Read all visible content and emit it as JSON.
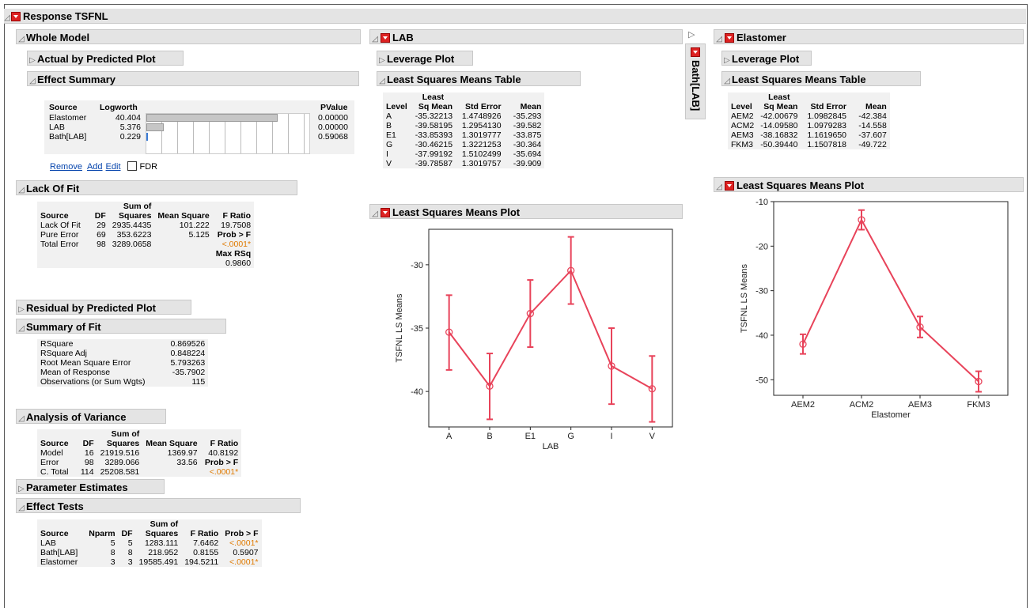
{
  "response_title": "Response TSFNL",
  "whole_model": {
    "title": "Whole Model",
    "actual_by_predicted": "Actual by Predicted Plot",
    "effect_summary": {
      "title": "Effect Summary",
      "headers": [
        "Source",
        "Logworth",
        "PValue"
      ],
      "rows": [
        {
          "source": "Elastomer",
          "logworth": "40.404",
          "pvalue": "0.00000",
          "bar": 40.404
        },
        {
          "source": "LAB",
          "logworth": "5.376",
          "pvalue": "0.00000",
          "bar": 5.376
        },
        {
          "source": "Bath[LAB]",
          "logworth": "0.229",
          "pvalue": "0.59068",
          "bar": 0.229
        }
      ],
      "links": {
        "remove": "Remove",
        "add": "Add",
        "edit": "Edit",
        "fdr": "FDR"
      }
    },
    "lack_of_fit": {
      "title": "Lack Of Fit",
      "h_sumof": "Sum of",
      "headers": [
        "Source",
        "DF",
        "Squares",
        "Mean Square",
        "F Ratio"
      ],
      "rows": [
        [
          "Lack Of Fit",
          "29",
          "2935.4435",
          "101.222",
          "19.7508"
        ],
        [
          "Pure Error",
          "69",
          "353.6223",
          "5.125",
          "Prob > F"
        ],
        [
          "Total Error",
          "98",
          "3289.0658",
          "",
          "<.0001*"
        ]
      ],
      "max_rsq_label": "Max RSq",
      "max_rsq": "0.9860"
    },
    "residual_by_predicted": "Residual by Predicted Plot",
    "summary_of_fit": {
      "title": "Summary of Fit",
      "rows": [
        [
          "RSquare",
          "0.869526"
        ],
        [
          "RSquare Adj",
          "0.848224"
        ],
        [
          "Root Mean Square Error",
          "5.793263"
        ],
        [
          "Mean of Response",
          "-35.7902"
        ],
        [
          "Observations (or Sum Wgts)",
          "115"
        ]
      ]
    },
    "anova": {
      "title": "Analysis of Variance",
      "h_sumof": "Sum of",
      "headers": [
        "Source",
        "DF",
        "Squares",
        "Mean Square",
        "F Ratio"
      ],
      "rows": [
        [
          "Model",
          "16",
          "21919.516",
          "1369.97",
          "40.8192"
        ],
        [
          "Error",
          "98",
          "3289.066",
          "33.56",
          "Prob > F"
        ],
        [
          "C. Total",
          "114",
          "25208.581",
          "",
          "<.0001*"
        ]
      ]
    },
    "parameter_estimates": "Parameter Estimates",
    "effect_tests": {
      "title": "Effect Tests",
      "h_sumof": "Sum of",
      "headers": [
        "Source",
        "Nparm",
        "DF",
        "Squares",
        "F Ratio",
        "Prob > F"
      ],
      "rows": [
        [
          "LAB",
          "5",
          "5",
          "1283.111",
          "7.6462",
          "<.0001*"
        ],
        [
          "Bath[LAB]",
          "8",
          "8",
          "218.952",
          "0.8155",
          "0.5907"
        ],
        [
          "Elastomer",
          "3",
          "3",
          "19585.491",
          "194.5211",
          "<.0001*"
        ]
      ]
    }
  },
  "lab": {
    "title": "LAB",
    "leverage_plot": "Leverage Plot",
    "ls_table": {
      "title": "Least Squares Means Table",
      "h_least": "Least",
      "headers": [
        "Level",
        "Sq Mean",
        "Std Error",
        "Mean"
      ],
      "rows": [
        [
          "A",
          "-35.32213",
          "1.4748926",
          "-35.293"
        ],
        [
          "B",
          "-39.58195",
          "1.2954130",
          "-39.582"
        ],
        [
          "E1",
          "-33.85393",
          "1.3019777",
          "-33.875"
        ],
        [
          "G",
          "-30.46215",
          "1.3221253",
          "-30.364"
        ],
        [
          "I",
          "-37.99192",
          "1.5102499",
          "-35.694"
        ],
        [
          "V",
          "-39.78587",
          "1.3019757",
          "-39.909"
        ]
      ]
    },
    "ls_plot_title": "Least Squares Means Plot"
  },
  "bath_lab_tab": "Bath[LAB]",
  "elastomer": {
    "title": "Elastomer",
    "leverage_plot": "Leverage Plot",
    "ls_table": {
      "title": "Least Squares Means Table",
      "h_least": "Least",
      "headers": [
        "Level",
        "Sq Mean",
        "Std Error",
        "Mean"
      ],
      "rows": [
        [
          "AEM2",
          "-42.00679",
          "1.0982845",
          "-42.384"
        ],
        [
          "ACM2",
          "-14.09580",
          "1.0979283",
          "-14.558"
        ],
        [
          "AEM3",
          "-38.16832",
          "1.1619650",
          "-37.607"
        ],
        [
          "FKM3",
          "-50.39440",
          "1.1507818",
          "-49.722"
        ]
      ]
    },
    "ls_plot_title": "Least Squares Means Plot"
  },
  "chart_data": [
    {
      "type": "line",
      "title": "",
      "xlabel": "LAB",
      "ylabel": "TSFNL LS Means",
      "categories": [
        "A",
        "B",
        "E1",
        "G",
        "I",
        "V"
      ],
      "values": [
        -35.32,
        -39.58,
        -33.85,
        -30.46,
        -37.99,
        -39.79
      ],
      "error_low": [
        -38.3,
        -42.2,
        -36.5,
        -33.1,
        -41.0,
        -42.4
      ],
      "error_high": [
        -32.4,
        -37.0,
        -31.2,
        -27.8,
        -35.0,
        -37.2
      ],
      "yticks": [
        -30,
        -35,
        -40
      ],
      "ylim": [
        -42.8,
        -27.2
      ],
      "color": "#e8435a"
    },
    {
      "type": "line",
      "title": "",
      "xlabel": "Elastomer",
      "ylabel": "TSFNL LS Means",
      "categories": [
        "AEM2",
        "ACM2",
        "AEM3",
        "FKM3"
      ],
      "values": [
        -42.01,
        -14.1,
        -38.17,
        -50.39
      ],
      "error_low": [
        -44.2,
        -16.3,
        -40.5,
        -52.7
      ],
      "error_high": [
        -39.8,
        -11.9,
        -35.8,
        -48.1
      ],
      "yticks": [
        -10,
        -20,
        -30,
        -40,
        -50
      ],
      "ylim": [
        -53.5,
        -10
      ],
      "color": "#e8435a"
    }
  ]
}
